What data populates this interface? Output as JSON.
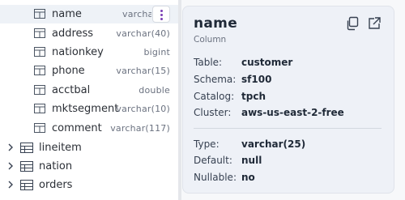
{
  "tree": {
    "columns": [
      {
        "name": "name",
        "type": "varchar",
        "highlighted": true
      },
      {
        "name": "address",
        "type": "varchar(40)"
      },
      {
        "name": "nationkey",
        "type": "bigint"
      },
      {
        "name": "phone",
        "type": "varchar(15)"
      },
      {
        "name": "acctbal",
        "type": "double"
      },
      {
        "name": "mktsegment",
        "type": "varchar(10)"
      },
      {
        "name": "comment",
        "type": "varchar(117)"
      }
    ],
    "tables": [
      {
        "name": "lineitem"
      },
      {
        "name": "nation"
      },
      {
        "name": "orders"
      }
    ]
  },
  "popover": {
    "title": "name",
    "subtitle": "Column",
    "details": [
      {
        "key": "Table:",
        "value": "customer"
      },
      {
        "key": "Schema:",
        "value": "sf100"
      },
      {
        "key": "Catalog:",
        "value": "tpch"
      },
      {
        "key": "Cluster:",
        "value": "aws-us-east-2-free"
      }
    ],
    "column_info": [
      {
        "key": "Type:",
        "value": "varchar(25)"
      },
      {
        "key": "Default:",
        "value": "null"
      },
      {
        "key": "Nullable:",
        "value": "no"
      }
    ],
    "icons": {
      "copy": "copy-icon",
      "open": "open-external-icon"
    }
  },
  "colors": {
    "accent": "#7b3fb5",
    "popover_bg": "#eef1f7"
  }
}
